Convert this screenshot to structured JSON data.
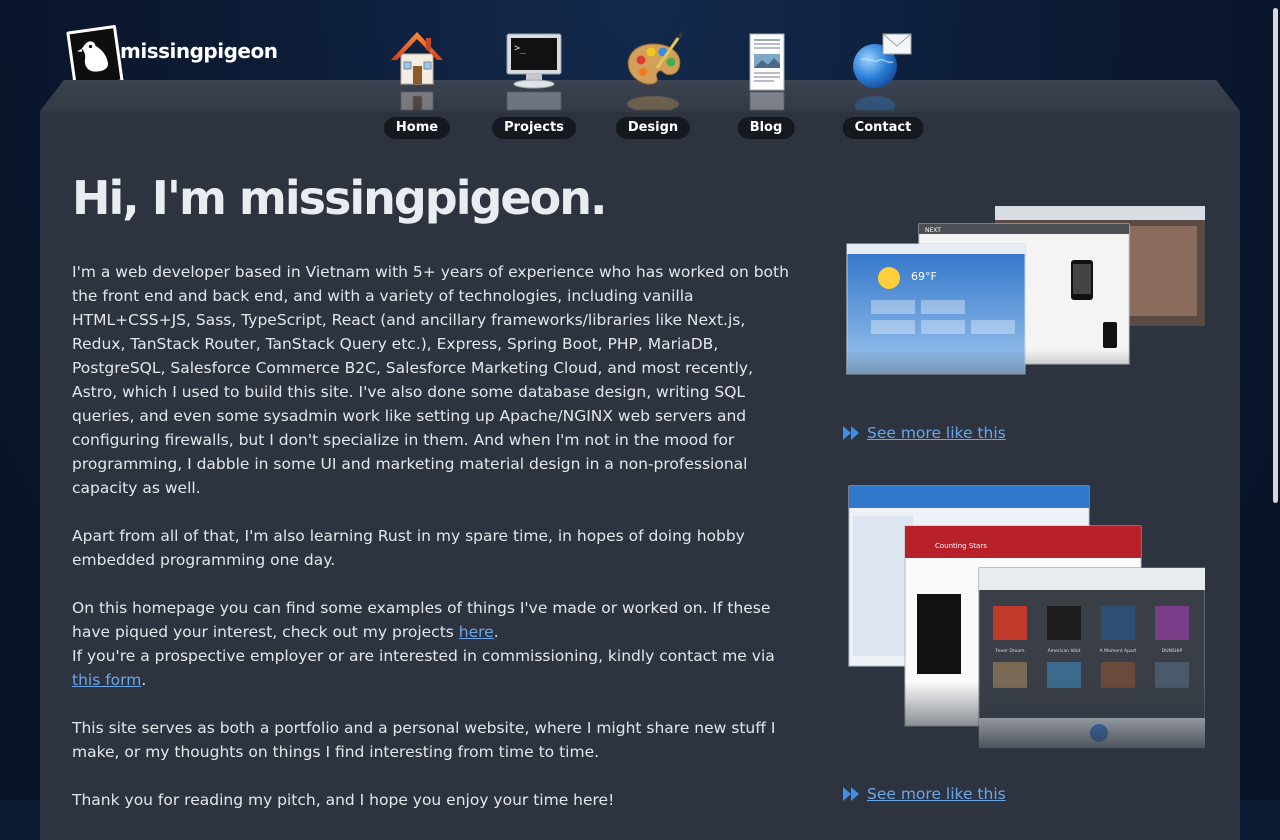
{
  "site": {
    "logo_text": "missingpigeon"
  },
  "nav": {
    "items": [
      {
        "label": "Home",
        "icon": "house-icon"
      },
      {
        "label": "Projects",
        "icon": "terminal-icon"
      },
      {
        "label": "Design",
        "icon": "palette-icon"
      },
      {
        "label": "Blog",
        "icon": "document-icon"
      },
      {
        "label": "Contact",
        "icon": "mail-globe-icon"
      }
    ]
  },
  "main": {
    "title": "Hi, I'm missingpigeon.",
    "paragraph1": "I'm a web developer based in Vietnam with 5+ years of experience who has worked on both the front end and back end, and with a variety of technologies, including vanilla HTML+CSS+JS, Sass, TypeScript, React (and ancillary frameworks/libraries like Next.js, Redux, TanStack Router, TanStack Query etc.), Express, Spring Boot, PHP, MariaDB, PostgreSQL, Salesforce Commerce B2C, Salesforce Marketing Cloud, and most recently, Astro, which I used to build this site. I've also done some database design, writing SQL queries, and even some sysadmin work like setting up Apache/NGINX web servers and configuring firewalls, but I don't specialize in them. And when I'm not in the mood for programming, I dabble in some UI and marketing material design in a non-professional capacity as well.",
    "paragraph2": "Apart from all of that, I'm also learning Rust in my spare time, in hopes of doing hobby embedded programming one day.",
    "paragraph3_a": "On this homepage you can find some examples of things I've made or worked on. If these have piqued your interest, check out my projects ",
    "paragraph3_link": "here",
    "paragraph3_b": ".",
    "paragraph3_c": "If you're a prospective employer or are interested in commissioning, kindly contact me via ",
    "paragraph3_link2": "this form",
    "paragraph3_d": ".",
    "paragraph4": "This site serves as both a portfolio and a personal website, where I might share new stuff I make, or my thoughts on things I find interesting from time to time.",
    "paragraph5": "Thank you for reading my pitch, and I hope you enjoy your time here!"
  },
  "sidebar": {
    "showcase1": {
      "weather_temp": "69°F",
      "link": "See more like this"
    },
    "showcase2": {
      "track": "Counting Stars",
      "albums": [
        "Fever Dream",
        "American Idiot",
        "A Moment Apart",
        "DUNSHIP"
      ],
      "link": "See more like this"
    }
  },
  "colors": {
    "accent_link": "#6ca6e8",
    "panel": "#2d3440",
    "background": "#0b1830"
  }
}
